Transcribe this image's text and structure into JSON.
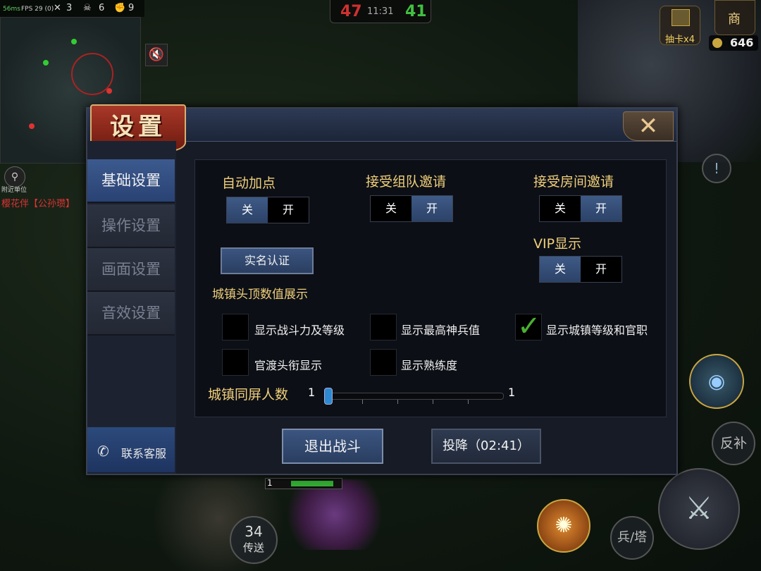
{
  "hud": {
    "ping": "56ms",
    "fps": "FPS 29 (0)",
    "kills": "3",
    "deaths": "6",
    "assists": "9",
    "score_red": "47",
    "score_time": "11:31",
    "score_green": "41",
    "draw_card_label": "抽卡x4",
    "shop_label": "商",
    "gold": "646",
    "nearby_label": "附近单位",
    "player_name": "樱花伴【公孙瓒】",
    "counter_label": "反补",
    "tower_label": "兵/塔",
    "teleport_count": "34",
    "teleport_label": "传送",
    "level_label": "1"
  },
  "settings": {
    "title": "设置",
    "close_icon": "close-x-icon",
    "sidebar": [
      {
        "label": "基础设置",
        "active": true
      },
      {
        "label": "操作设置",
        "active": false
      },
      {
        "label": "画面设置",
        "active": false
      },
      {
        "label": "音效设置",
        "active": false
      }
    ],
    "contact_label": "联系客服",
    "auto_point": {
      "label": "自动加点",
      "off": "关",
      "on": "开",
      "value": "off"
    },
    "team_invite": {
      "label": "接受组队邀请",
      "off": "关",
      "on": "开",
      "value": "on"
    },
    "room_invite": {
      "label": "接受房间邀请",
      "off": "关",
      "on": "开",
      "value": "on"
    },
    "vip_display": {
      "label": "VIP显示",
      "off": "关",
      "on": "开",
      "value": "off"
    },
    "real_name_button": "实名认证",
    "town_section_label": "城镇头顶数值展示",
    "checkboxes": [
      {
        "label": "显示战斗力及等级",
        "checked": false
      },
      {
        "label": "显示最高神兵值",
        "checked": false
      },
      {
        "label": "显示城镇等级和官职",
        "checked": true
      },
      {
        "label": "官渡头衔显示",
        "checked": false
      },
      {
        "label": "显示熟练度",
        "checked": false
      }
    ],
    "town_players": {
      "label": "城镇同屏人数",
      "min": "1",
      "max": "1",
      "value": 1
    },
    "exit_button": "退出战斗",
    "surrender_button": "投降（02:41）"
  },
  "colors": {
    "accent_gold": "#f0cf7a",
    "active_blue": "#3c5a8e",
    "check_green": "#4ab030"
  }
}
